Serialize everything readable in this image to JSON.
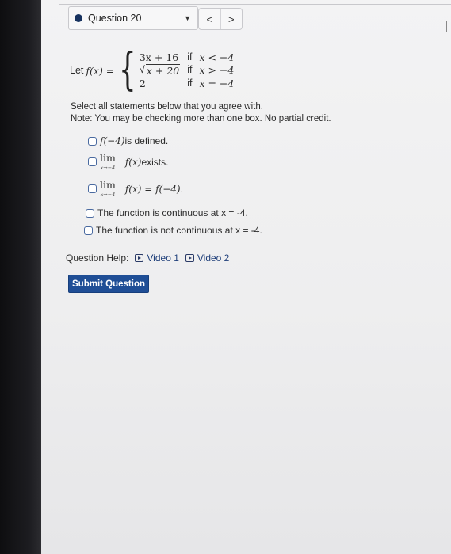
{
  "header": {
    "question_title": "Question 20",
    "prev_symbol": "<",
    "next_symbol": ">",
    "dropdown_symbol": "▼"
  },
  "function_def": {
    "let_label": "Let",
    "name": "f(x) =",
    "cases": [
      {
        "expr": "3x + 16",
        "cond_word": "if",
        "cond": "x < −4"
      },
      {
        "expr": "x + 20",
        "sqrt": true,
        "cond_word": "if",
        "cond": "x > −4"
      },
      {
        "expr": "2",
        "cond_word": "if",
        "cond": "x = −4"
      }
    ]
  },
  "instructions": {
    "line1": "Select all statements below that you agree with.",
    "line2": "Note: You may be checking more than one box. No partial credit."
  },
  "options": [
    {
      "math": "f(−4)",
      "text": " is defined."
    },
    {
      "lim_word": "lim",
      "lim_sub": "x→−4",
      "math": "f(x)",
      "text": " exists."
    },
    {
      "lim_word": "lim",
      "lim_sub": "x→−4",
      "math": "f(x) = f(−4)",
      "text": "."
    },
    {
      "text": "The function is continuous at x = -4."
    },
    {
      "text": "The function is not continuous at x = -4."
    }
  ],
  "help": {
    "label": "Question Help:",
    "video1": "Video 1",
    "video2": "Video 2"
  },
  "submit_label": "Submit Question",
  "colors": {
    "accent": "#1f4e96",
    "status_dot": "#17325f"
  }
}
